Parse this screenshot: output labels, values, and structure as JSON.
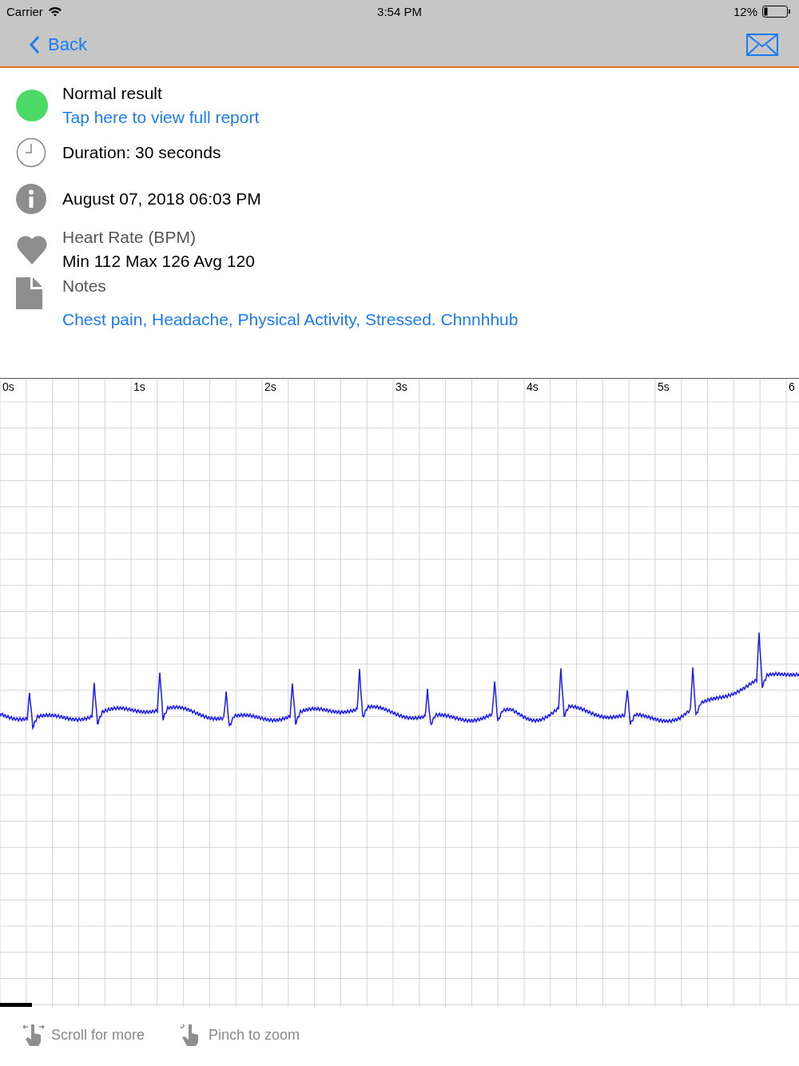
{
  "status_bar": {
    "carrier": "Carrier",
    "time": "3:54 PM",
    "battery": "12%"
  },
  "nav": {
    "back": "Back"
  },
  "result": {
    "status": "Normal result",
    "color": "#4cd964",
    "link": "Tap here to view full report"
  },
  "duration": "Duration: 30 seconds",
  "date": "August 07, 2018 06:03 PM",
  "heart_rate": {
    "label": "Heart Rate (BPM)",
    "value": "Min 112 Max 126 Avg 120"
  },
  "notes": {
    "label": "Notes",
    "text": "Chest pain, Headache, Physical Activity, Stressed. Chnnhhub"
  },
  "ecg": {
    "time_labels": [
      "0s",
      "1s",
      "2s",
      "3s",
      "4s",
      "5s",
      "6"
    ]
  },
  "hints": [
    {
      "kind": "scroll",
      "label": "Scroll for more"
    },
    {
      "kind": "pinch",
      "label": "Pinch to zoom"
    }
  ]
}
